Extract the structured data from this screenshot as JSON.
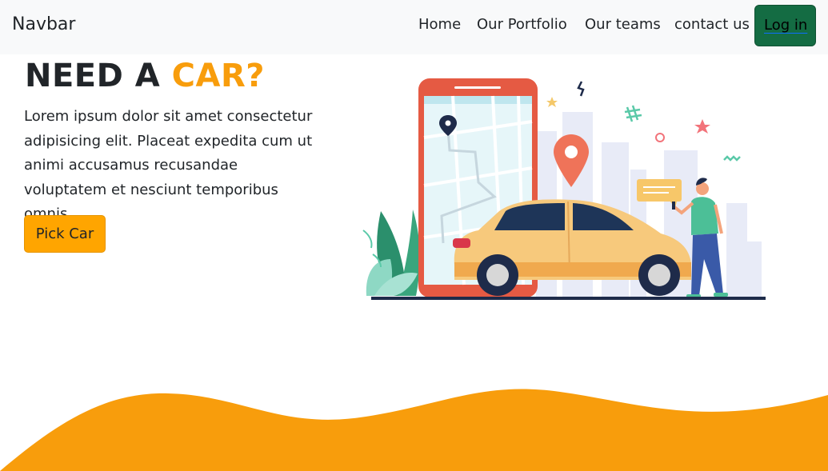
{
  "navbar": {
    "brand": "Navbar",
    "links": [
      "Home",
      "Our Portfolio",
      "Our teams",
      "contact us"
    ],
    "login_label": "Log in"
  },
  "hero": {
    "title_prefix": "NEED A ",
    "title_accent": "CAR?",
    "paragraph": "Lorem ipsum dolor sit amet consectetur adipisicing elit. Placeat expedita cum ut animi accusamus recusandae voluptatem et nesciunt temporibus omnis.",
    "button_label": "Pick Car"
  },
  "colors": {
    "accent": "#f89d0c",
    "login_button": "#146c43",
    "navbar_bg": "#f8f9fa"
  },
  "illustration": {
    "icon_names": [
      "phone-icon",
      "map-pin-icon",
      "car-icon",
      "person-icon",
      "chat-bubble-icon",
      "plant-icon"
    ]
  }
}
